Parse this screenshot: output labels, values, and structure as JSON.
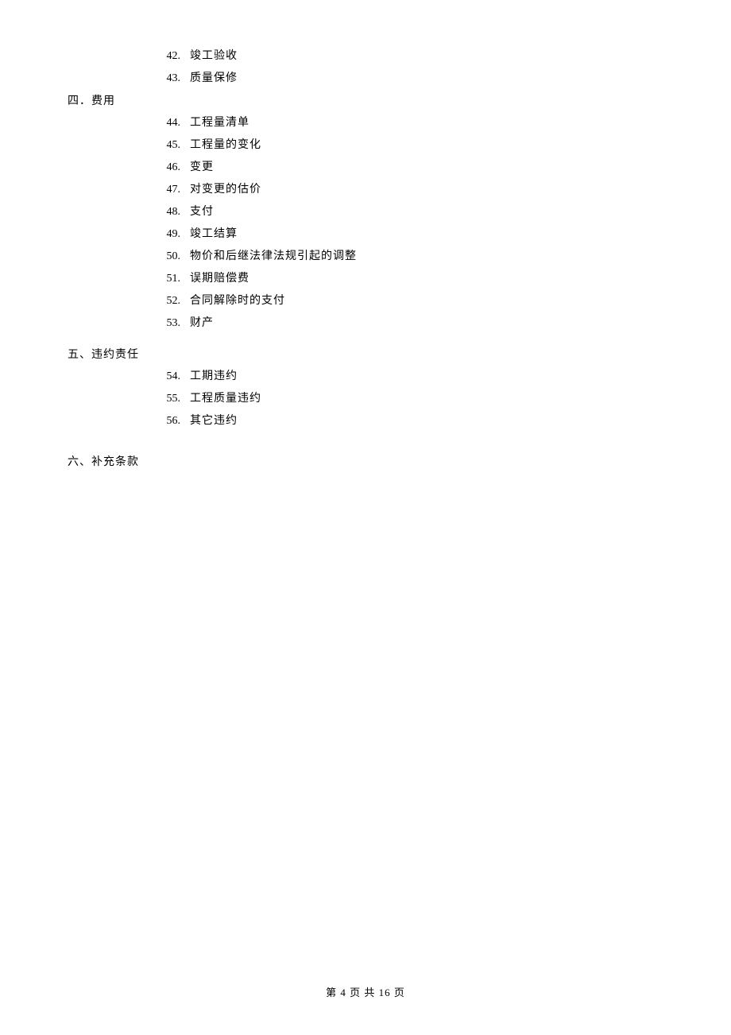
{
  "section_before": {
    "items": [
      {
        "num": "42.",
        "text": "竣工验收"
      },
      {
        "num": "43.",
        "text": "质量保修"
      }
    ]
  },
  "section_four": {
    "heading": "四．费用",
    "items": [
      {
        "num": "44.",
        "text": "工程量清单"
      },
      {
        "num": "45.",
        "text": "工程量的变化"
      },
      {
        "num": "46.",
        "text": "变更"
      },
      {
        "num": "47.",
        "text": "对变更的估价"
      },
      {
        "num": "48.",
        "text": "支付"
      },
      {
        "num": "49.",
        "text": "竣工结算"
      },
      {
        "num": "50.",
        "text": "物价和后继法律法规引起的调整"
      },
      {
        "num": "51.",
        "text": "误期赔偿费"
      },
      {
        "num": "52.",
        "text": "合同解除时的支付"
      },
      {
        "num": "53.",
        "text": "财产"
      }
    ]
  },
  "section_five": {
    "heading": "五、违约责任",
    "items": [
      {
        "num": "54.",
        "text": "工期违约"
      },
      {
        "num": "55.",
        "text": "工程质量违约"
      },
      {
        "num": "56.",
        "text": "其它违约"
      }
    ]
  },
  "section_six": {
    "heading": "六、补充条款"
  },
  "footer": "第 4 页 共 16 页"
}
